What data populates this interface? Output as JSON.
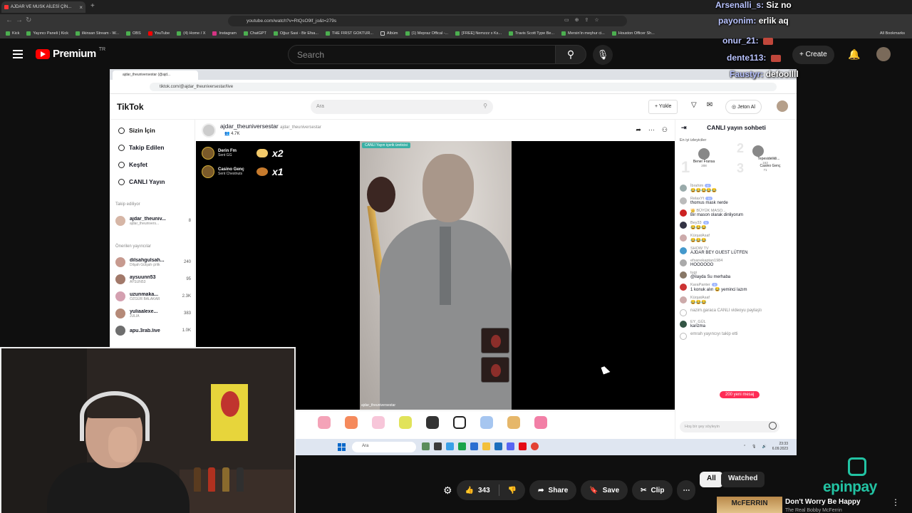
{
  "browser": {
    "tab_title": "AJDAR VE MUSK AİLESİ ÇİN...",
    "url": "youtube.com/watch?v=RtQsO9lf_jo&t=279s",
    "bookmarks": [
      "Kick",
      "Yayıncı Paneli | Kick",
      "ilkinsan Stream - W...",
      "OBS",
      "YouTube",
      "(4) Home / X",
      "Instagram",
      "ChatGPT",
      "Oğuz Sasi - Bir Efsa...",
      "THE FIRST GOKTUR...",
      "Albüm",
      "(1) Mepraz Offical -...",
      "[FREE] Nemzzz x Ks...",
      "Travis Scott Type Be...",
      "Mersin'in meşhur ci...",
      "Houston Officer Sh..."
    ],
    "all_bookmarks": "All Bookmarks"
  },
  "youtube": {
    "logo_text": "Premium",
    "region": "TR",
    "search_placeholder": "Search",
    "create_label": "Create",
    "actions": {
      "likes": "343",
      "share": "Share",
      "save": "Save",
      "clip": "Clip"
    },
    "filters": [
      "All",
      "Watched"
    ],
    "recommendation": {
      "thumb_text": "McFERRIN",
      "title": "Don't Worry Be Happy",
      "channel": "The Real Bobby McFerrin"
    },
    "sponsor": "epinpay"
  },
  "inner_browser": {
    "tab_title": "ajdar_theuniversestar (@ajd...",
    "url": "tiktok.com/@ajdar_theuniversestar/live"
  },
  "tiktok": {
    "logo": "TikTok",
    "search_placeholder": "Ara",
    "upload": "Yükle",
    "jeton": "Jeton Al",
    "nav": [
      "Sizin İçin",
      "Takip Edilen",
      "Keşfet",
      "CANLI Yayın"
    ],
    "following_header": "Takip ediliyor",
    "following": [
      {
        "name": "ajdar_theuniv...",
        "sub": "ajdar_theunivers...",
        "count": "8"
      }
    ],
    "suggested_header": "Önerilen yayıncılar",
    "suggested": [
      {
        "name": "dilsahgulsah...",
        "sub": "Dilşah Gülşah çirlik",
        "count": "240"
      },
      {
        "name": "aysuunn53",
        "sub": "AYSUN53",
        "count": "95"
      },
      {
        "name": "uzunmaka...",
        "sub": "ÖZGÜR BALAKAR",
        "count": "2.3K"
      },
      {
        "name": "yuliaalexe...",
        "sub": "JULIA",
        "count": "383"
      },
      {
        "name": "apu.3rab.live",
        "sub": "",
        "count": "1.0K"
      }
    ],
    "streamer": {
      "name": "ajdar_theuniversestar",
      "handle": "ajdar_theuniversestar",
      "viewers": "4.7K",
      "badge": "CANLI Yayın içerik üreticisi",
      "cam_user": "ajdar_theuniversestar"
    },
    "gifts": [
      {
        "name": "Derin Fm",
        "sent": "Sent GG",
        "mult": "x2"
      },
      {
        "name": "Casino Genç",
        "sent": "Sent Chestnuts",
        "mult": "x1"
      }
    ],
    "chat": {
      "title": "CANLI yayın sohbeti",
      "top_viewers": "En iyi izleyiciler",
      "podium": [
        {
          "rank": "1",
          "name": "Bener Fransa",
          "points": "208"
        },
        {
          "rank": "2",
          "name": "Tepesidelikli...",
          "points": "163"
        },
        {
          "rank": "3",
          "name": "Casino Genç",
          "points": "71"
        }
      ],
      "messages": [
        {
          "user": "İbrahim",
          "level": "6",
          "text": "😂😂😂😂😂"
        },
        {
          "user": "RelaxYt",
          "level": "11",
          "text": "thomus mask nerde"
        },
        {
          "user": "👑 BÜYÜK MASO...",
          "level": "",
          "text": "Bir mason olarak dinliyorum"
        },
        {
          "user": "Bey33",
          "level": "5",
          "text": "😂😂😂"
        },
        {
          "user": "KürşatAsaf",
          "level": "",
          "text": "😂😂😂"
        },
        {
          "user": "SHOW TV",
          "level": "",
          "text": "AJDAR BEY GUEST LÜTFEN"
        },
        {
          "user": "efsanekaptan1984",
          "level": "",
          "text": "HOOOOOO"
        },
        {
          "user": "tugi",
          "level": "",
          "text": "@ilayda Su merhaba"
        },
        {
          "user": "KaraPanter",
          "level": "3",
          "text": "1 konuk alın 😂 yeminci lazım"
        },
        {
          "user": "KürşatAsaf",
          "level": "",
          "text": "😂😂😂"
        }
      ],
      "share_line": "nazim.garaca CANLI videoyu paylaştı",
      "ey_user": "EY_GÜL",
      "ey_text": "karizma",
      "new_messages": "200 yeni mesaj",
      "follow_line": "emrah yayıncıyı takip etti",
      "input_placeholder": "Hoş bir şey söyleyin"
    }
  },
  "taskbar": {
    "search": "Ara",
    "time": "23:33",
    "date": "6.09.2023"
  },
  "overlay_chat": [
    {
      "user": "Arsenalli_s:",
      "text": "Siz no"
    },
    {
      "user": "payonim:",
      "text": "erlik aq"
    },
    {
      "user": "onur_21:",
      "text": ""
    },
    {
      "user": "dente113:",
      "text": ""
    },
    {
      "user": "Faustyr:",
      "text": "defoollll"
    }
  ],
  "colors": {
    "yt_bg": "#0f0f0f",
    "yt_red": "#ff0000",
    "tiktok_pink": "#fe2c55",
    "epin_teal": "#22c3a3"
  }
}
